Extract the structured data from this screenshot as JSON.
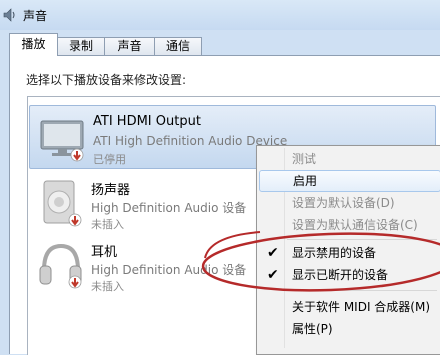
{
  "window": {
    "title": "声音",
    "icon": "speaker-icon"
  },
  "tabs": [
    {
      "label": "播放",
      "active": true
    },
    {
      "label": "录制",
      "active": false
    },
    {
      "label": "声音",
      "active": false
    },
    {
      "label": "通信",
      "active": false
    }
  ],
  "instruction": "选择以下播放设备来修改设置:",
  "devices": [
    {
      "name": "ATI HDMI Output",
      "description": "ATI High Definition Audio Device",
      "status": "已停用",
      "icon": "monitor-icon",
      "selected": true
    },
    {
      "name": "扬声器",
      "description": "High Definition Audio 设备",
      "status": "未插入",
      "icon": "speaker-icon",
      "selected": false
    },
    {
      "name": "耳机",
      "description": "High Definition Audio 设备",
      "status": "未插入",
      "icon": "headphones-icon",
      "selected": false
    }
  ],
  "context_menu": {
    "items": [
      {
        "label": "测试",
        "enabled": false
      },
      {
        "label": "启用",
        "enabled": true,
        "highlighted": true
      },
      {
        "label": "设置为默认设备(D)",
        "enabled": false
      },
      {
        "label": "设置为默认通信设备(C)",
        "enabled": false
      },
      {
        "label": "显示禁用的设备",
        "enabled": true,
        "checked": true
      },
      {
        "label": "显示已断开的设备",
        "enabled": true,
        "checked": true
      },
      {
        "label": "关于软件 MIDI 合成器(M)",
        "enabled": true
      },
      {
        "label": "属性(P)",
        "enabled": true
      }
    ]
  },
  "colors": {
    "annotation_circle": "#b52a2a",
    "status_down_arrow": "#c0392b"
  }
}
